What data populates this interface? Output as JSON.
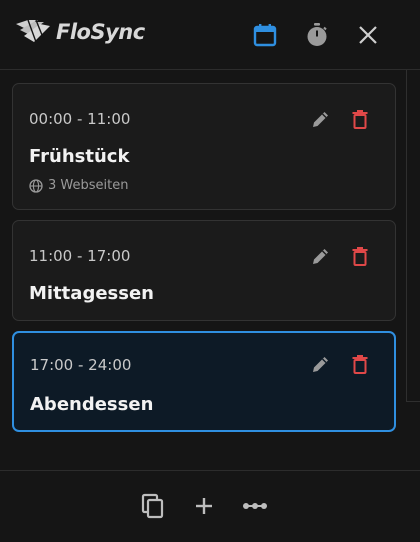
{
  "header": {
    "app_name": "FloSync",
    "icons": {
      "logo": "flosync-logo",
      "calendar": "calendar-icon",
      "timer": "stopwatch-icon",
      "close": "close-icon"
    },
    "calendar_active": true
  },
  "colors": {
    "accent": "#2f8fe0",
    "delete": "#e04848",
    "icon_muted": "#9a9a9a",
    "card_bg": "#1b1b1b",
    "card_selected_bg": "#0d1a26"
  },
  "slots": [
    {
      "time": "00:00 - 11:00",
      "title": "Frühstück",
      "subtitle": "3 Webseiten",
      "selected": false
    },
    {
      "time": "11:00 - 17:00",
      "title": "Mittagessen",
      "selected": false
    },
    {
      "time": "17:00 - 24:00",
      "title": "Abendessen",
      "selected": true
    }
  ],
  "footer": {
    "icons": {
      "copy": "copy-icon",
      "add": "plus-icon",
      "more": "more-horizontal-icon"
    }
  }
}
